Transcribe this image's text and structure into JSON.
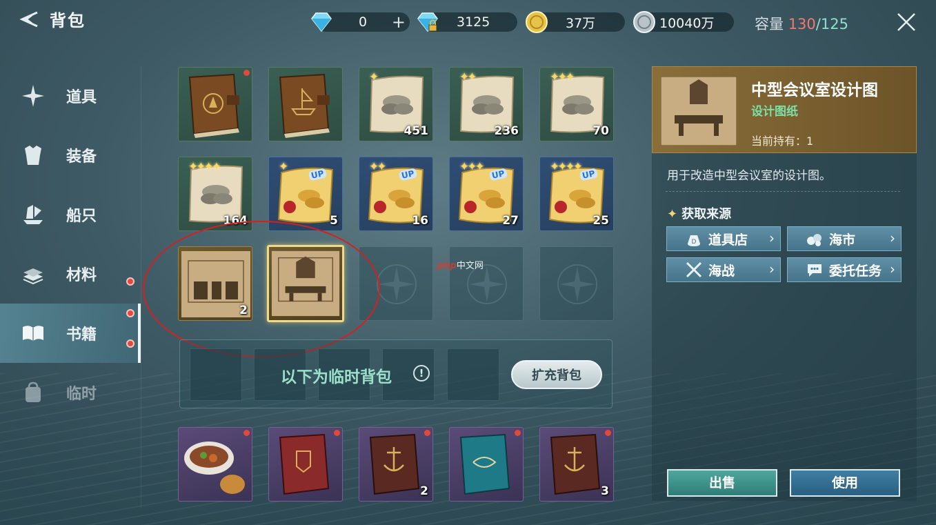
{
  "header": {
    "title": "背包",
    "currencies": [
      {
        "name": "diamond-icon",
        "value": "0",
        "has_plus": true
      },
      {
        "name": "locked-diamond-icon",
        "value": "3125"
      },
      {
        "name": "gold-coin-icon",
        "value": "37万"
      },
      {
        "name": "silver-coin-icon",
        "value": "10040万"
      }
    ],
    "capacity_label": "容量",
    "capacity_used": "130",
    "capacity_total": "/125"
  },
  "sidebar": {
    "items": [
      {
        "label": "道具",
        "icon": "star-icon"
      },
      {
        "label": "装备",
        "icon": "armor-icon"
      },
      {
        "label": "船只",
        "icon": "ship-icon"
      },
      {
        "label": "材料",
        "icon": "material-icon"
      },
      {
        "label": "书籍",
        "icon": "book-icon",
        "active": true
      },
      {
        "label": "临时",
        "icon": "bag-icon"
      }
    ]
  },
  "grid": {
    "row1": [
      {
        "type": "brown-book",
        "count": "",
        "stars": ""
      },
      {
        "type": "brown-book-ship",
        "count": "",
        "stars": ""
      },
      {
        "type": "scroll-barrels",
        "count": "451",
        "stars": "✦"
      },
      {
        "type": "scroll-barrels",
        "count": "236",
        "stars": "✦✦"
      },
      {
        "type": "scroll-barrels",
        "count": "70",
        "stars": "✦✦✦"
      }
    ],
    "row2": [
      {
        "type": "scroll-barrels",
        "count": "164",
        "stars": "✦✦✦✦"
      },
      {
        "type": "gold-scroll",
        "count": "5",
        "stars": "✦",
        "up": "UP"
      },
      {
        "type": "gold-scroll",
        "count": "16",
        "stars": "✦✦",
        "up": "UP"
      },
      {
        "type": "gold-scroll",
        "count": "27",
        "stars": "✦✦✦",
        "up": "UP"
      },
      {
        "type": "gold-scroll",
        "count": "25",
        "stars": "✦✦✦✦",
        "up": "UP"
      }
    ],
    "row3": [
      {
        "type": "blueprint",
        "count": "2"
      },
      {
        "type": "blueprint-selected",
        "count": ""
      }
    ],
    "bottom_row": [
      {
        "type": "food-stew"
      },
      {
        "type": "red-book"
      },
      {
        "type": "anchor-book",
        "count": "2"
      },
      {
        "type": "teal-book"
      },
      {
        "type": "anchor-book",
        "count": "3"
      }
    ]
  },
  "watermark": {
    "brand": "php",
    "text": "中文网"
  },
  "temp_bag": {
    "label": "以下为临时背包",
    "info": "!",
    "expand_button": "扩充背包"
  },
  "detail": {
    "name": "中型会议室设计图",
    "type": "设计图纸",
    "held": "当前持有：1",
    "description": "用于改造中型会议室的设计图。",
    "source_title": "获取来源",
    "source_star": "✦",
    "sources": [
      "道具店",
      "海市",
      "海战",
      "委托任务"
    ],
    "chevron": "›",
    "sell": "出售",
    "use": "使用"
  },
  "colors": {
    "capacity_over": "#f07a6e",
    "capacity_total": "#8fe0c6",
    "type_green": "#7be0a8",
    "red_dot": "#e24a3e"
  }
}
